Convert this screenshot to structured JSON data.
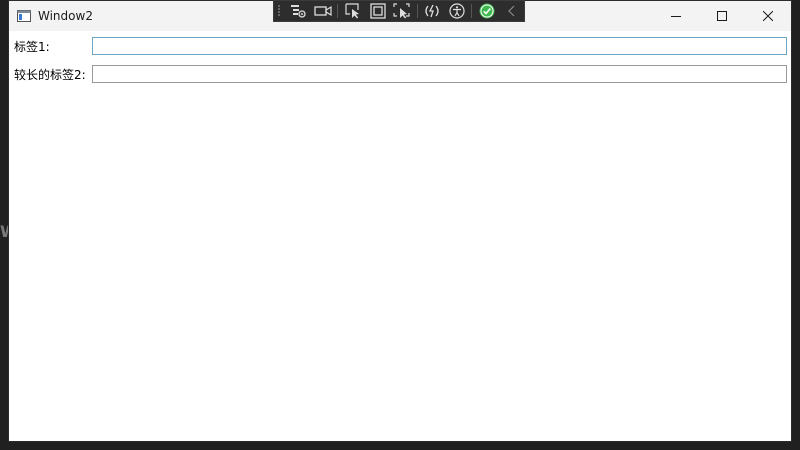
{
  "window": {
    "title": "Window2"
  },
  "form": {
    "rows": [
      {
        "label": "标签1:",
        "value": "",
        "focused": true
      },
      {
        "label": "较长的标签2:",
        "value": "",
        "focused": false
      }
    ]
  },
  "colors": {
    "focus_border": "#6ea6c6",
    "input_border": "#9a9a9a",
    "toolbar_bg": "#2d2d2d",
    "check_green": "#3fb950"
  },
  "debug_toolbar": {
    "buttons": [
      "live-visual-tree-icon",
      "track-focus-icon",
      "select-element-icon",
      "display-layout-adorners-icon",
      "selection-preview-icon",
      "hot-reload-icon",
      "accessibility-icon",
      "binding-status-icon",
      "collapse-toolbar-icon"
    ]
  },
  "background_glyph": "W"
}
